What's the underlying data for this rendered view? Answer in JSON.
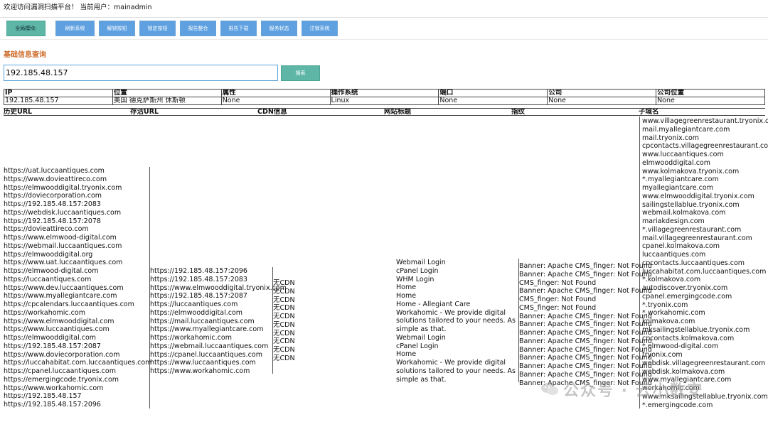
{
  "header": {
    "welcome": "欢迎访问漏洞扫描平台！ 当前用户：mainadmin"
  },
  "toolbar": {
    "buttons": [
      "全局模块:",
      "刷新系统",
      "解锁按钮",
      "锁定按钮",
      "报告整合",
      "报告下载",
      "服务状态",
      "注销系统"
    ]
  },
  "section": {
    "title": "基础信息查询"
  },
  "search": {
    "value": "192.185.48.157",
    "button": "搜索"
  },
  "info_table": {
    "headers": [
      "IP",
      "位置",
      "属性",
      "操作系统",
      "端口",
      "公司",
      "公司位置"
    ],
    "row": [
      "192.185.48.157",
      "美国 德克萨斯州 休斯顿",
      "None",
      "Linux",
      "None",
      "None",
      "None"
    ]
  },
  "history_table": {
    "headers": [
      "历史URL",
      "存活URL",
      "CDN信息",
      "网站标题",
      "指纹",
      "子域名"
    ],
    "history_urls": [
      "https://uat.luccaantiques.com",
      "https://www.dovieattireco.com",
      "https://elmwooddigital.tryonix.com",
      "https://doviecorporation.com",
      "https://192.185.48.157:2083",
      "https://webdisk.luccaantiques.com",
      "https://192.185.48.157:2078",
      "https://dovieattireco.com",
      "https://www.elmwood-digital.com",
      "https://webmail.luccaantiques.com",
      "https://elmwooddigital.org",
      "https://www.uat.luccaantiques.com",
      "https://elmwood-digital.com",
      "https://luccaantiques.com",
      "https://www.dev.luccaantiques.com",
      "https://www.myallegiantcare.com",
      "https://cpcalendars.luccaantiques.com",
      "https://workahomic.com",
      "https://www.elmwooddigital.com",
      "https://www.luccaantiques.com",
      "https://elmwooddigital.com",
      "https://192.185.48.157:2087",
      "https://www.doviecorporation.com",
      "https://luccahabitat.com.luccaantiques.com",
      "https://cpanel.luccaantiques.com",
      "https://emergingcode.tryonix.com",
      "https://www.workahomic.com",
      "https://192.185.48.157",
      "https://192.185.48.157:2096"
    ],
    "live_urls": [
      "https://192.185.48.157:2096",
      "https://192.185.48.157:2083",
      "https://www.elmwooddigital.tryonix.com",
      "https://192.185.48.157:2087",
      "https://luccaantiques.com",
      "https://elmwooddigital.com",
      "https://mail.luccaantiques.com",
      "https://www.myallegiantcare.com",
      "https://workahomic.com",
      "https://webmail.luccaantiques.com",
      "https://cpanel.luccaantiques.com",
      "https://www.luccaantiques.com",
      "https://www.workahomic.com"
    ],
    "cdn": [
      "无CDN",
      "无CDN",
      "无CDN",
      "无CDN",
      "无CDN",
      "无CDN",
      "无CDN",
      "无CDN",
      "无CDN",
      "无CDN"
    ],
    "titles": [
      "Webmail Login",
      "cPanel Login",
      "WHM Login",
      "Home",
      "Home",
      "Home - Allegiant Care",
      "Workahomic - We provide digital",
      "solutions tailored to your needs. As",
      "simple as that.",
      "Webmail Login",
      "cPanel Login",
      "Home",
      "Workahomic - We provide digital",
      "solutions tailored to your needs. As",
      "simple as that."
    ],
    "fingerprints": [
      "Banner: Apache CMS_finger: Not Found",
      "Banner: Apache CMS_finger: Not Found",
      "CMS_finger: Not Found",
      "Banner: Apache CMS_finger: Not Found",
      "CMS_finger: Not Found",
      "CMS_finger: Not Found",
      "Banner: Apache CMS_finger: Not Found",
      "Banner: Apache CMS_finger: Not Found",
      "Banner: Apache CMS_finger: Not Found",
      "Banner: Apache CMS_finger: Not Found",
      "Banner: Apache CMS_finger: Not Found",
      "Banner: Apache CMS_finger: Not Found",
      "Banner: Apache CMS_finger: Not Found",
      "Banner: Apache CMS_finger: Not Found",
      "Banner: Apache CMS_finger: Not Found"
    ],
    "subdomains": [
      "www.villagegreenrestaurant.tryonix.com",
      "mail.myallegiantcare.com",
      "mail.tryonix.com",
      "cpcontacts.villagegreenrestaurant.com",
      "www.luccaantiques.com",
      "elmwooddigital.com",
      "www.kolmakova.tryonix.com",
      "*.myallegiantcare.com",
      "myallegiantcare.com",
      "www.elmwooddigital.tryonix.com",
      "sailingstellablue.tryonix.com",
      "webmail.kolmakova.com",
      "mariakdesign.com",
      "*.villagegreenrestaurant.com",
      "mail.villagegreenrestaurant.com",
      "cpanel.kolmakova.com",
      "luccaantiques.com",
      "cpcontacts.luccaantiques.com",
      "luccahabitat.com.luccaantiques.com",
      "*.kolmakova.com",
      "autodiscover.tryonix.com",
      "cpanel.emergingcode.com",
      "*.tryonix.com",
      "*.workahomic.com",
      "kolmakova.com",
      "mksailingstellablue.tryonix.com",
      "cpcontacts.kolmakova.com",
      "*.elmwood-digital.com",
      "tryonix.com",
      "webdisk.villagegreenrestaurant.com",
      "webdisk.kolmakova.com",
      "www.myallegiantcare.com",
      "workahomic.com",
      "www.mksailingstellablue.tryonix.com",
      "*.emergingcode.com"
    ]
  },
  "watermark": {
    "text": "公众号 · 云小数安",
    "icon": "wechat-icon",
    "color": "#999999"
  }
}
